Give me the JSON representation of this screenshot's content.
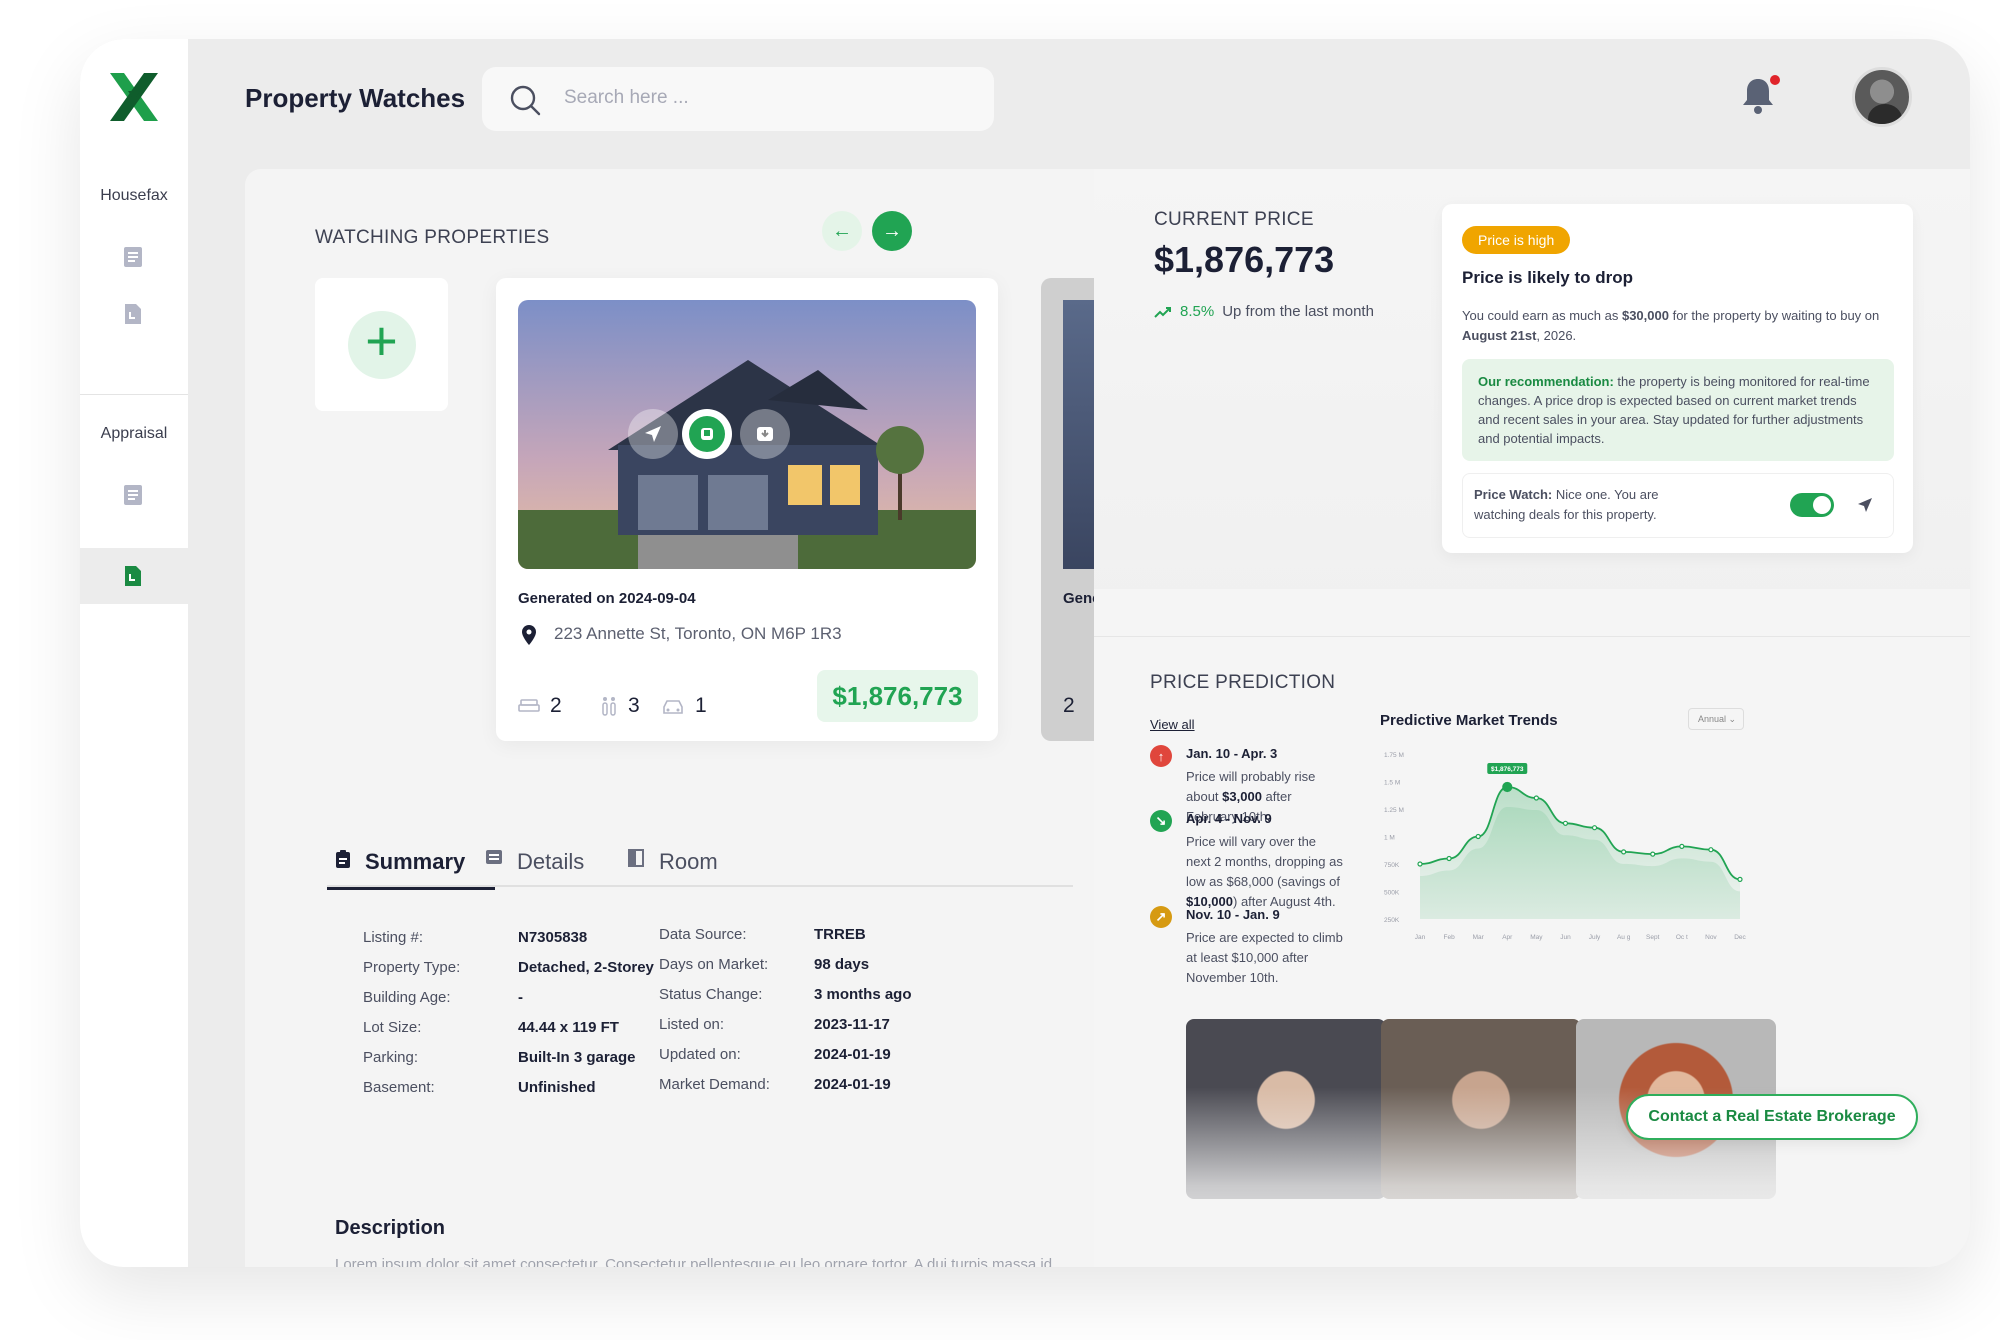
{
  "app": {
    "title": "Property Watches",
    "search_placeholder": "Search here ..."
  },
  "colors": {
    "brand_green": "#21a453",
    "dark_navy": "#1c2035",
    "warning": "#f0a500",
    "danger": "#e0242a"
  },
  "sidebar": {
    "section_1": "Housefax",
    "section_2": "Appraisal"
  },
  "watching": {
    "label": "WATCHING PROPERTIES",
    "card": {
      "generated": "Generated on 2024-09-04",
      "address": "223 Annette St, Toronto, ON M6P 1R3",
      "beds": "2",
      "baths": "3",
      "garage": "1",
      "price": "$1,876,773"
    },
    "card2": {
      "generated_prefix": "Gene",
      "beds": "2"
    }
  },
  "tabs": [
    {
      "label": "Summary"
    },
    {
      "label": "Details"
    },
    {
      "label": "Room"
    }
  ],
  "summary_left": [
    {
      "k": "Listing #:",
      "v": "N7305838"
    },
    {
      "k": "Property Type:",
      "v": "Detached, 2-Storey"
    },
    {
      "k": "Building Age:",
      "v": "-"
    },
    {
      "k": "Lot Size:",
      "v": "44.44 x 119 FT"
    },
    {
      "k": "Parking:",
      "v": "Built-In 3 garage"
    },
    {
      "k": "Basement:",
      "v": "Unfinished"
    }
  ],
  "summary_right": [
    {
      "k": "Data Source:",
      "v": "TRREB"
    },
    {
      "k": "Days on Market:",
      "v": "98 days"
    },
    {
      "k": "Status Change:",
      "v": "3 months ago"
    },
    {
      "k": "Listed on:",
      "v": "2023-11-17"
    },
    {
      "k": "Updated on:",
      "v": "2024-01-19"
    },
    {
      "k": "Market Demand:",
      "v": "2024-01-19"
    }
  ],
  "description": {
    "title": "Description",
    "text": "Lorem ipsum dolor sit amet consectetur. Consectetur pellentesque eu leo ornare tortor. A dui turpis massa id diam amet imperdiet. Sed amet ullamcorper mattis placerat platea tortor erat. Amet pulvinar sed sed"
  },
  "current_price": {
    "label": "CURRENT PRICE",
    "value": "$1,876,773",
    "change_pct": "8.5%",
    "change_text": "Up from the last month"
  },
  "price_card": {
    "badge": "Price is high",
    "headline": "Price is likely to drop",
    "earn_1": "You could earn as much as ",
    "earn_amount": "$30,000",
    "earn_2": " for the property by waiting to buy on ",
    "earn_date": "August 21st",
    "earn_3": ", 2026.",
    "rec_label": "Our recommendation:",
    "rec_text": " the property is being monitored for real-time changes. A price drop is expected based on current market trends and recent sales in your area. Stay updated for further adjustments and potential impacts.",
    "watch_label": "Price Watch:",
    "watch_text": " Nice one. You are watching deals for this property."
  },
  "prediction": {
    "label": "PRICE PREDICTION",
    "view_all": "View all",
    "items": [
      {
        "date": "Jan. 10 - Apr. 3",
        "t1": "Price will probably rise about ",
        "b": "$3,000",
        "t2": " after February 10th.",
        "color": "#e0463c",
        "dir": "up"
      },
      {
        "date": "Apr. 4 - Nov. 9",
        "t1": "Price will vary over the next 2 months, dropping as low as $68,000 (savings of ",
        "b": "$10,000",
        "t2": ") after August 4th.",
        "color": "#21a453",
        "dir": "down"
      },
      {
        "date": "Nov. 10 - Jan. 9",
        "t1": "Price are expected to climb at least $10,000 after November 10th.",
        "b": "",
        "t2": "",
        "color": "#d69a12",
        "dir": "up"
      }
    ]
  },
  "chart_data": {
    "type": "area",
    "title": "Predictive Market Trends",
    "period_select": "Annual",
    "categories": [
      "Jan",
      "Feb",
      "Mar",
      "Apr",
      "May",
      "Jun",
      "July",
      "Au g",
      "Sept",
      "Oc t",
      "Nov",
      "Dec"
    ],
    "y_ticks": [
      "1.75 M",
      "1.5 M",
      "1.25 M",
      "1 M",
      "750K",
      "500K",
      "250K"
    ],
    "ylim": [
      250000,
      1750000
    ],
    "series": [
      {
        "values": [
          750000,
          800000,
          1000000,
          1450000,
          1350000,
          1120000,
          1080000,
          860000,
          840000,
          910000,
          880000,
          610000
        ]
      }
    ],
    "highlight": {
      "category": "Apr",
      "label": "$1,876,773"
    },
    "grid": false
  },
  "contact": {
    "label": "Contact a Real Estate Brokerage"
  }
}
